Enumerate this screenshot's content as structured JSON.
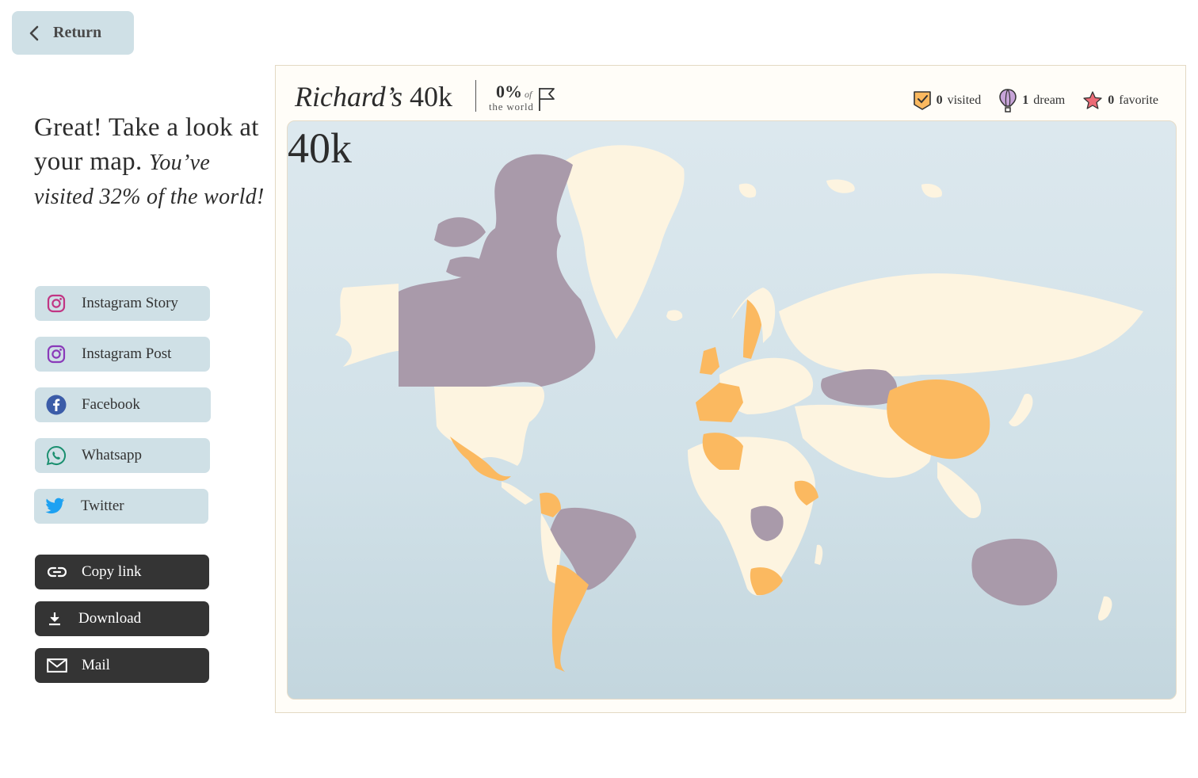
{
  "nav": {
    "return_label": "Return"
  },
  "headline": {
    "main": "Great! Take a look at your map.",
    "sub": "You’ve visited 32% of the world!"
  },
  "share": {
    "instagram_story": "Instagram Story",
    "instagram_post": "Instagram Post",
    "facebook": "Facebook",
    "whatsapp": "Whatsapp",
    "twitter": "Twitter"
  },
  "actions": {
    "copy_link": "Copy link",
    "download": "Download",
    "mail": "Mail"
  },
  "card": {
    "owner": "Richard’s",
    "brand": "40k",
    "percent": "0%",
    "of": "of",
    "world": "the world",
    "stats": {
      "visited_count": "0",
      "visited_label": "visited",
      "dream_count": "1",
      "dream_label": "dream",
      "favorite_count": "0",
      "favorite_label": "favorite"
    }
  },
  "watermark": "40k",
  "colors": {
    "visited": "#fbb960",
    "dream": "#a99aaa",
    "land": "#fdf4e0",
    "ocean": "#d6e5eb",
    "button_light": "#cfe0e6",
    "button_dark": "#343434"
  },
  "icons": {
    "return": "chevron-left-icon",
    "instagram": "instagram-icon",
    "facebook": "facebook-icon",
    "whatsapp": "whatsapp-icon",
    "twitter": "twitter-icon",
    "copy_link": "link-icon",
    "download": "download-icon",
    "mail": "mail-icon",
    "visited": "check-badge-icon",
    "dream": "balloon-icon",
    "favorite": "star-icon",
    "world": "flag-icon"
  }
}
